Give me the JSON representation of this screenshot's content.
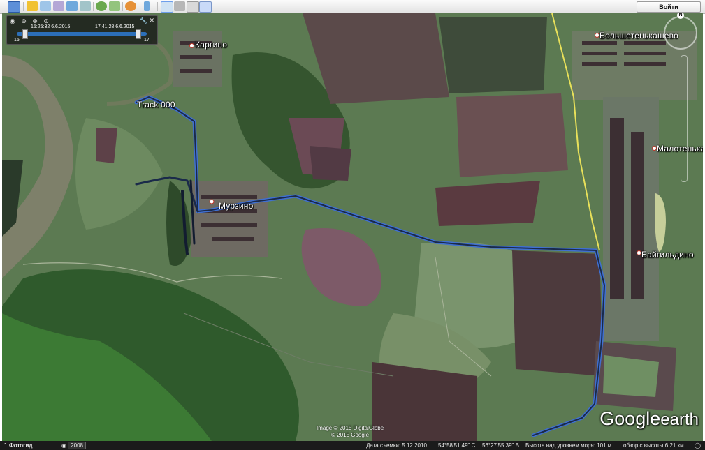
{
  "toolbar": {
    "signin_label": "Войти",
    "buttons": [
      "sidebar-toggle",
      "add-placemark",
      "add-polygon",
      "add-path",
      "add-image-overlay",
      "record-tour",
      "historical-imagery",
      "sun",
      "planets",
      "ruler",
      "email",
      "print",
      "save-image",
      "view-in-maps"
    ]
  },
  "timeline": {
    "start_time": "15:25:32 6.6.2015",
    "end_time": "17:41:28 6.6.2015",
    "range_start": "15",
    "range_end": "17"
  },
  "map": {
    "places": [
      {
        "id": "kargino",
        "name": "Каргино"
      },
      {
        "id": "murzino",
        "name": "Мурзино"
      },
      {
        "id": "bolshetenkashevo",
        "name": "Большетенькашево"
      },
      {
        "id": "malotenka",
        "name": "Малотенька"
      },
      {
        "id": "baygildino",
        "name": "Байгильдино"
      }
    ],
    "track_label": "Track 000",
    "colors": {
      "track": "#1a2a4a",
      "track_edge": "#3f6fd1",
      "road": "#e8e05a",
      "river": "#7e806a"
    }
  },
  "attribution": {
    "line1": "Image © 2015 DigitalGlobe",
    "line2": "© 2015 Google"
  },
  "logo": {
    "word1": "Google",
    "word2": "earth"
  },
  "statusbar": {
    "tour_guide": "Фотогид",
    "imagery_year": "2008",
    "imagery_date": "Дата съемки: 5.12.2010",
    "latitude": "54°58'51.49\" С",
    "longitude": "56°27'55.39\" В",
    "elevation": "Высота над уровнем моря:  101 м",
    "eye_alt": "обзор с высоты   6.21 км"
  }
}
